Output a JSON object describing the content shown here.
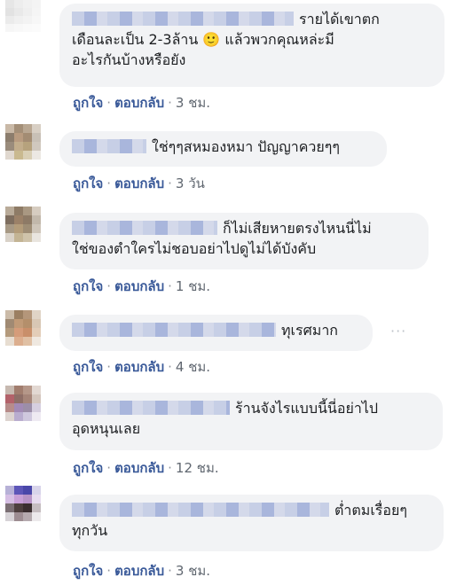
{
  "comments": [
    {
      "line1": "รายได้เขาตก",
      "line2": "เดือนละเป็น 2-3ล้าน 🙂 แล้วพวกคุณหล่ะมี",
      "line3": "อะไรกันบ้างหรือยัง",
      "like": "ถูกใจ",
      "reply": "ตอบกลับ",
      "time": "3 ชม."
    },
    {
      "line1": "ใช่ๆๆสหมองหมา ปัญญาควยๆๆ",
      "like": "ถูกใจ",
      "reply": "ตอบกลับ",
      "time": "3 วัน"
    },
    {
      "line1": "ก็ไม่เสียหายตรงไหนนี่ไม่",
      "line2": "ใช่ของตำใครไม่ชอบอย่าไปดูไม่ได้บังคับ",
      "like": "ถูกใจ",
      "reply": "ตอบกลับ",
      "time": "1 ชม."
    },
    {
      "line1": "ทุเรศมาก",
      "more": "···",
      "like": "ถูกใจ",
      "reply": "ตอบกลับ",
      "time": "4 ชม."
    },
    {
      "line1": "ร้านจังไรแบบนี้นี่อย่าไป",
      "line2": "อุดหนุนเลย",
      "like": "ถูกใจ",
      "reply": "ตอบกลับ",
      "time": "12 ชม."
    },
    {
      "line1": "ต่ำตมเรื่อยๆ",
      "line2": "ทุกวัน",
      "like": "ถูกใจ",
      "reply": "ตอบกลับ",
      "time": "3 ชม."
    }
  ],
  "colors": {
    "bubble": "#f2f3f5",
    "link": "#385898",
    "meta": "#606770"
  }
}
